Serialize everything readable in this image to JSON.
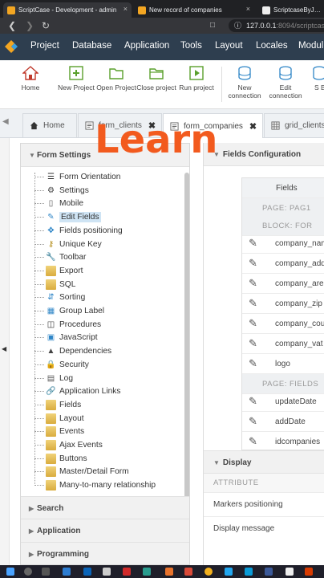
{
  "browser": {
    "tabs": [
      {
        "title": "ScriptCase - Development - admin",
        "close": "×"
      },
      {
        "title": "New record of companies",
        "close": "×"
      },
      {
        "title": "ScriptcaseByJamie",
        "close": ""
      }
    ],
    "url_host": "127.0.0.1",
    "url_rest": ":8094/scriptcase"
  },
  "menubar": {
    "items": [
      "Project",
      "Database",
      "Application",
      "Tools",
      "Layout",
      "Locales",
      "Modul"
    ]
  },
  "toolbar": {
    "buttons": [
      {
        "label": "Home",
        "icon": "home-icon"
      },
      {
        "label": "New Project",
        "icon": "new-project-icon"
      },
      {
        "label": "Open Project",
        "icon": "open-folder-icon"
      },
      {
        "label": "Close project",
        "icon": "close-folder-icon"
      },
      {
        "label": "Run project",
        "icon": "run-icon"
      },
      {
        "label": "New connection",
        "icon": "database-add-icon"
      },
      {
        "label": "Edit connection",
        "icon": "database-edit-icon"
      },
      {
        "label": "S Bu",
        "icon": "database-icon"
      }
    ]
  },
  "project_tabs": [
    {
      "label": "Home",
      "icon": "home-icon"
    },
    {
      "label": "form_clients",
      "icon": "form-icon",
      "close": "✖"
    },
    {
      "label": "form_companies",
      "icon": "form-icon",
      "close": "✖"
    },
    {
      "label": "grid_clients",
      "icon": "grid-icon"
    }
  ],
  "overlay_text": "Learn",
  "left_panel": {
    "title": "Form Settings",
    "items": [
      {
        "label": "Form Orientation",
        "icon": "list-icon"
      },
      {
        "label": "Settings",
        "icon": "gear-icon"
      },
      {
        "label": "Mobile",
        "icon": "mobile-icon"
      },
      {
        "label": "Edit Fields",
        "icon": "edit-fields-icon",
        "selected": true
      },
      {
        "label": "Fields positioning",
        "icon": "move-icon"
      },
      {
        "label": "Unique Key",
        "icon": "key-icon"
      },
      {
        "label": "Toolbar",
        "icon": "wrench-icon"
      },
      {
        "label": "Export",
        "icon": "folder-icon"
      },
      {
        "label": "SQL",
        "icon": "folder-icon"
      },
      {
        "label": "Sorting",
        "icon": "sort-icon"
      },
      {
        "label": "Group Label",
        "icon": "table-icon"
      },
      {
        "label": "Procedures",
        "icon": "procedures-icon"
      },
      {
        "label": "JavaScript",
        "icon": "javascript-icon"
      },
      {
        "label": "Dependencies",
        "icon": "dependencies-icon"
      },
      {
        "label": "Security",
        "icon": "lock-icon"
      },
      {
        "label": "Log",
        "icon": "log-icon"
      },
      {
        "label": "Application Links",
        "icon": "link-icon"
      },
      {
        "label": "Fields",
        "icon": "folder-icon"
      },
      {
        "label": "Layout",
        "icon": "folder-icon"
      },
      {
        "label": "Events",
        "icon": "folder-icon"
      },
      {
        "label": "Ajax Events",
        "icon": "folder-icon"
      },
      {
        "label": "Buttons",
        "icon": "folder-icon"
      },
      {
        "label": "Master/Detail Form",
        "icon": "folder-icon"
      },
      {
        "label": "Many-to-many relationship",
        "icon": "folder-icon"
      }
    ],
    "sections": [
      "Search",
      "Application",
      "Programming"
    ]
  },
  "right_panel": {
    "title": "Fields Configuration",
    "fields_header": "Fields",
    "rows": [
      {
        "type": "group",
        "label": "PAGE: PAG1"
      },
      {
        "type": "group",
        "label": "BLOCK: FOR"
      },
      {
        "type": "field",
        "label": "company_nam"
      },
      {
        "type": "field",
        "label": "company_add"
      },
      {
        "type": "field",
        "label": "company_are"
      },
      {
        "type": "field",
        "label": "company_zip"
      },
      {
        "type": "field",
        "label": "company_cou"
      },
      {
        "type": "field",
        "label": "company_vat"
      },
      {
        "type": "field",
        "label": "logo"
      },
      {
        "type": "group",
        "label": "PAGE: FIELDS"
      },
      {
        "type": "field",
        "label": "updateDate"
      },
      {
        "type": "field",
        "label": "addDate"
      },
      {
        "type": "field",
        "label": "idcompanies"
      }
    ],
    "display_title": "Display",
    "attribute_header": "ATTRIBUTE",
    "attributes": [
      "Markers positioning",
      "Display message"
    ]
  }
}
